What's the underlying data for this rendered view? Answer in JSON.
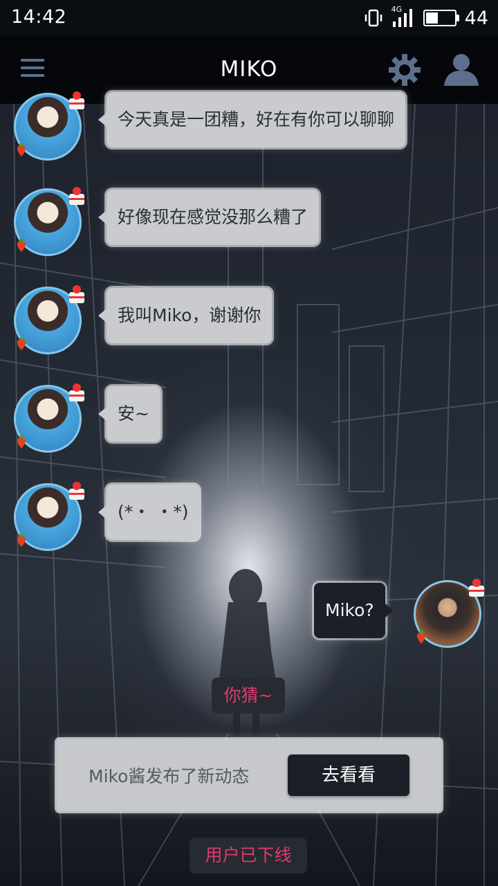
{
  "status_bar": {
    "time": "14:42",
    "network": "4G",
    "battery_level": "44"
  },
  "app_bar": {
    "title": "MIKO"
  },
  "messages": [
    {
      "sender": "miko",
      "text": "今天真是一团糟，好在有你可以聊聊"
    },
    {
      "sender": "miko",
      "text": "好像现在感觉没那么糟了"
    },
    {
      "sender": "miko",
      "text": "我叫Miko，谢谢你"
    },
    {
      "sender": "miko",
      "text": "安~"
    },
    {
      "sender": "miko",
      "text": "(*・ ・*)"
    },
    {
      "sender": "me",
      "text": "Miko?"
    }
  ],
  "hint_reply": "你猜~",
  "notice": {
    "text": "Miko酱发布了新动态",
    "button": "去看看"
  },
  "offline_status": "用户已下线",
  "colors": {
    "accent": "#e03a6e",
    "app_bar": "#05070a",
    "bubble": "#c9cbcf",
    "bubble_me": "#1b1f28",
    "icon": "#5d6f8c"
  }
}
